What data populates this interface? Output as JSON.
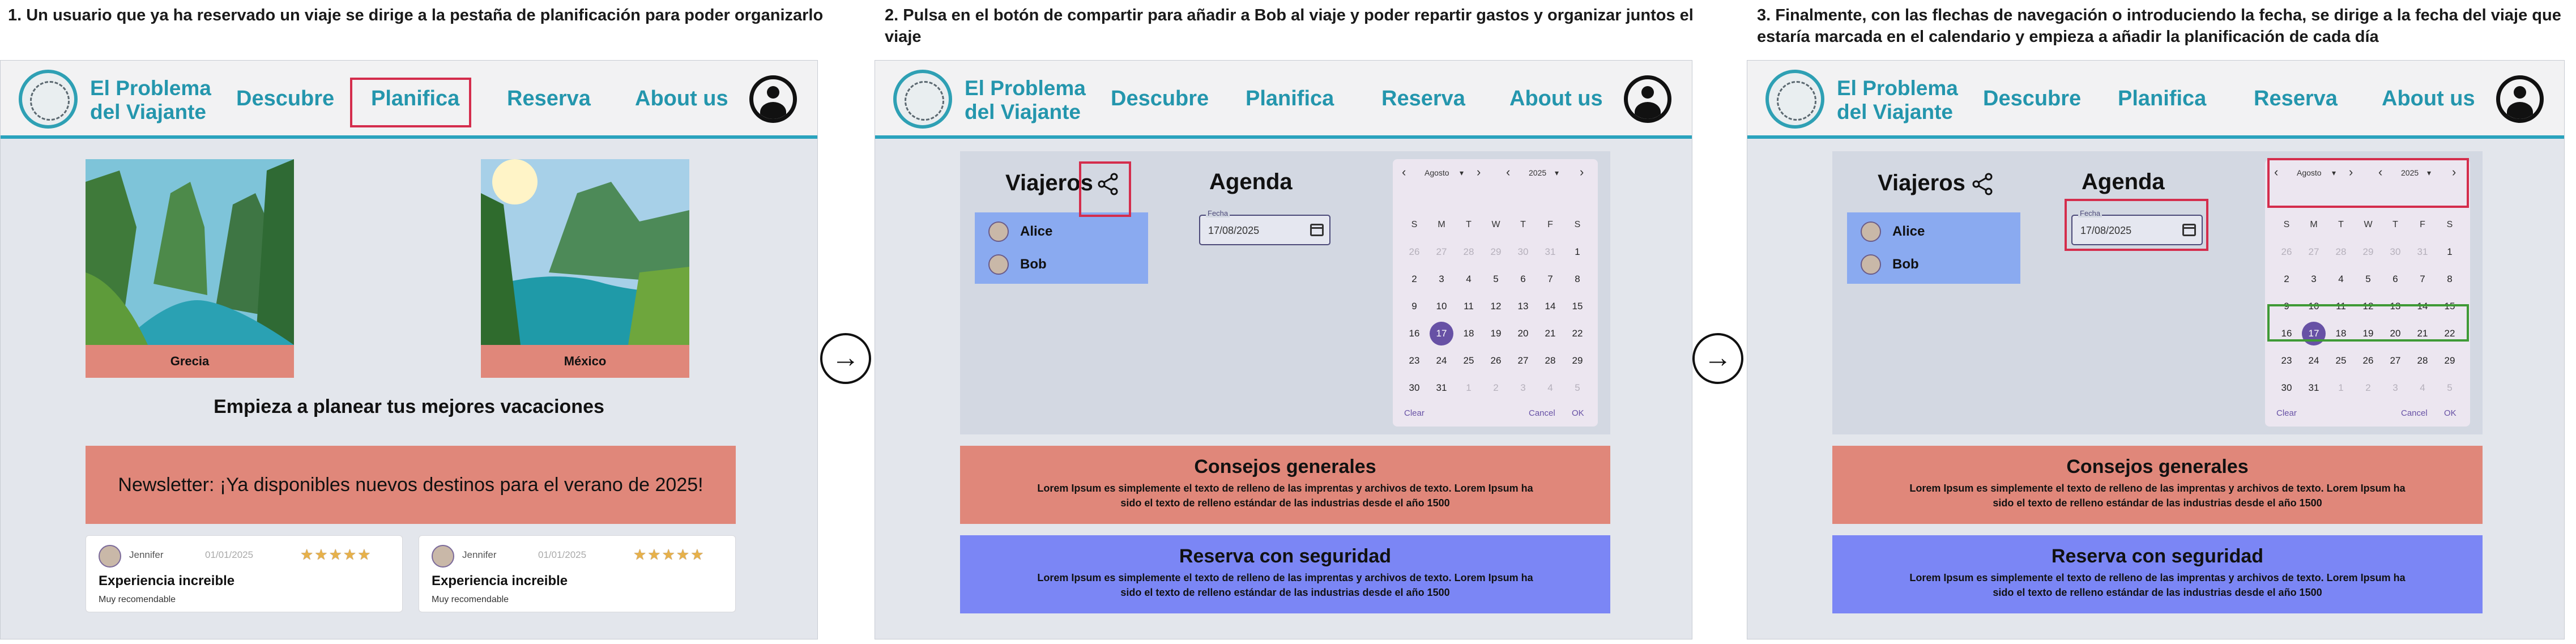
{
  "captions": [
    "1. Un usuario que ya ha reservado un viaje se dirige a la pestaña de planificación para poder organizarlo",
    "2. Pulsa en el botón de compartir para añadir a Bob al viaje y poder repartir gastos y organizar juntos el viaje",
    "3. Finalmente, con las flechas de navegación o introduciendo la fecha, se dirige a la fecha del viaje que estaría marcada en el calendario y empieza a añadir la planificación de cada día"
  ],
  "brand": {
    "line1": "El Problema",
    "line2": "del Viajante"
  },
  "nav": [
    "Descubre",
    "Planifica",
    "Reserva",
    "About us"
  ],
  "home": {
    "destinations": [
      "Grecia",
      "México"
    ],
    "tagline": "Empieza a planear tus mejores vacaciones",
    "newsletter": "Newsletter:   ¡Ya disponibles nuevos destinos para el verano de 2025!",
    "reviews": [
      {
        "name": "Jennifer",
        "date": "01/01/2025",
        "stars": "★★★★★",
        "title": "Experiencia increible",
        "body": "Muy recomendable"
      },
      {
        "name": "Jennifer",
        "date": "01/01/2025",
        "stars": "★★★★★",
        "title": "Experiencia increible",
        "body": "Muy recomendable"
      }
    ]
  },
  "planner": {
    "viajeros_title": "Viajeros",
    "travellers": [
      "Alice",
      "Bob"
    ],
    "agenda_title": "Agenda",
    "date_label": "Fecha",
    "date_value": "17/08/2025",
    "month": "Agosto",
    "year": "2025",
    "weekdays": [
      "S",
      "M",
      "T",
      "W",
      "T",
      "F",
      "S"
    ],
    "weeks": [
      [
        "26",
        "27",
        "28",
        "29",
        "30",
        "31",
        "1"
      ],
      [
        "2",
        "3",
        "4",
        "5",
        "6",
        "7",
        "8"
      ],
      [
        "9",
        "10",
        "11",
        "12",
        "13",
        "14",
        "15"
      ],
      [
        "16",
        "17",
        "18",
        "19",
        "20",
        "21",
        "22"
      ],
      [
        "23",
        "24",
        "25",
        "26",
        "27",
        "28",
        "29"
      ],
      [
        "30",
        "31",
        "1",
        "2",
        "3",
        "4",
        "5"
      ]
    ],
    "selected_day": "17",
    "clear_label": "Clear",
    "cancel_label": "Cancel",
    "ok_label": "OK"
  },
  "info": {
    "consejos_title": "Consejos generales",
    "reserva_title": "Reserva con seguridad",
    "lorem": "Lorem Ipsum es simplemente el texto de relleno de las imprentas y archivos de texto. Lorem Ipsum ha sido el texto de relleno estándar de las industrias desde el año 1500"
  },
  "colors": {
    "accent": "#2496ad",
    "highlight": "#d42d4c",
    "highlight_week": "#3f9a36",
    "salmon": "#e0877a",
    "travellers_bg": "#8aaaf0",
    "reserva_bg": "#7b86f5"
  },
  "icons": [
    "share-icon",
    "arrow-right-icon",
    "calendar-icon",
    "profile-icon",
    "chevron-left-icon",
    "chevron-right-icon"
  ]
}
